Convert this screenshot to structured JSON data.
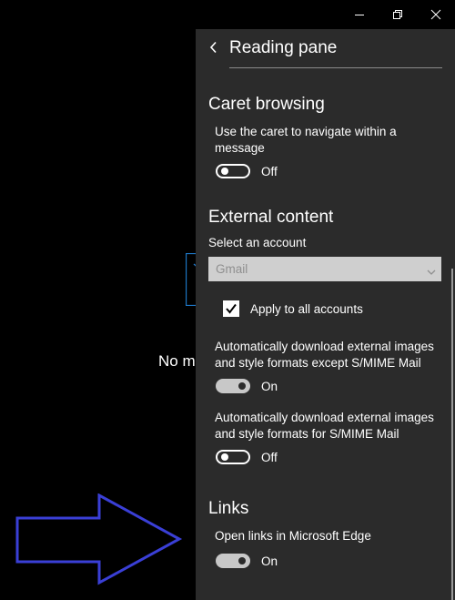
{
  "window": {
    "minimize_icon": "minimize-icon",
    "restore_icon": "restore-icon",
    "close_icon": "close-icon"
  },
  "background": {
    "empty_message": "No mo"
  },
  "panel": {
    "title": "Reading pane",
    "back_icon": "chevron-left-icon",
    "caret_browsing": {
      "title": "Caret browsing",
      "description": "Use the caret to navigate within a message",
      "toggle_state": "Off"
    },
    "external_content": {
      "title": "External content",
      "select_label": "Select an account",
      "select_value": "Gmail",
      "apply_all_label": "Apply to all accounts",
      "apply_all_checked": true,
      "auto_download_except_label": "Automatically download external images and style formats except S/MIME Mail",
      "auto_download_except_state": "On",
      "auto_download_smime_label": "Automatically download external images and style formats for S/MIME Mail",
      "auto_download_smime_state": "Off"
    },
    "links": {
      "title": "Links",
      "open_in_edge_label": "Open links in Microsoft Edge",
      "open_in_edge_state": "On"
    }
  },
  "colors": {
    "panel_bg": "#2b2b2b",
    "background": "#000000",
    "annotation_arrow": "#3a3fd6",
    "toggle_on": "#c8c8c8",
    "select_bg": "#cfcfcf"
  }
}
